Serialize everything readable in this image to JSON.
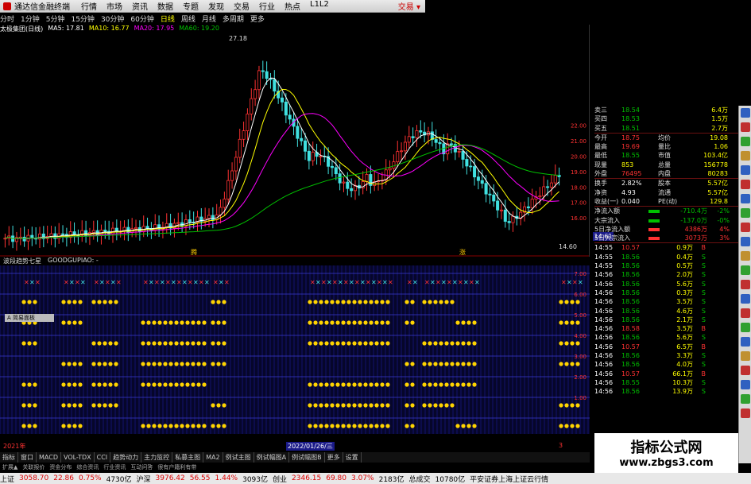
{
  "app": {
    "title": "通达信金融终端",
    "trade": "交易 ▾",
    "menus": [
      "行情",
      "市场",
      "资讯",
      "数据",
      "专题",
      "发现",
      "交易",
      "行业",
      "热点",
      "L1L2"
    ]
  },
  "periods": [
    "分时",
    "1分钟",
    "5分钟",
    "15分钟",
    "30分钟",
    "60分钟",
    "日线",
    "周线",
    "月线",
    "多周期",
    "更多"
  ],
  "stock": {
    "name": "太极集团(日线)",
    "ma": [
      {
        "label": "MA5: 17.81",
        "color": "#ffffff"
      },
      {
        "label": "MA10: 16.77",
        "color": "#ffff00"
      },
      {
        "label": "MA20: 17.95",
        "color": "#ff00ff"
      },
      {
        "label": "MA60: 19.20",
        "color": "#00c000"
      }
    ]
  },
  "chart_data": {
    "type": "candlestick",
    "high_label": "27.18",
    "low_label": "14.60",
    "price_tag": "14.61",
    "right_axis": [
      "22.00",
      "21.00",
      "20.00",
      "19.00",
      "18.00",
      "17.00",
      "16.00"
    ],
    "indicator_axis": [
      "7.00",
      "6.00",
      "5.00",
      "4.00",
      "3.00",
      "2.00",
      "1.00"
    ],
    "markers": [
      "腾",
      "涨"
    ],
    "dot_rows": 7,
    "segments": [
      [
        80,
        3
      ],
      [
        30,
        3
      ],
      [
        80,
        3
      ],
      [
        30,
        3
      ],
      [
        80,
        3
      ],
      [
        30,
        3
      ]
    ]
  },
  "indicator": {
    "title": "波段趋势七星",
    "code": "GOODGUPIAO: -",
    "mini_button": "A 简易面板"
  },
  "dates": {
    "left": "2021年",
    "mid": "2022/01/26/三",
    "right": "3"
  },
  "tabs": [
    "指标",
    "窗口",
    "MACD",
    "VOL-TDX",
    "CCI",
    "趋势动力",
    "主力监控",
    "私募主图",
    "MA2",
    "例试主图",
    "例试幅图A",
    "例试幅图B",
    "更多",
    "设置"
  ],
  "tabs2": [
    "扩展▲",
    "关联报价",
    "资金分布",
    "综合资讯",
    "行业资讯",
    "互动问答",
    "很有户籍利有带"
  ],
  "quote": {
    "asks": [
      {
        "l": "卖三",
        "p": "18.54",
        "v": "6.4万"
      },
      {
        "l": "买四",
        "p": "18.53",
        "v": "1.5万"
      },
      {
        "l": "买五",
        "p": "18.51",
        "v": "2.7万"
      }
    ],
    "stats": [
      {
        "a": "今开",
        "b": "18.75",
        "c": "均价",
        "d": "19.08"
      },
      {
        "a": "最高",
        "b": "19.69",
        "c": "量比",
        "d": "1.06"
      },
      {
        "a": "最低",
        "b": "18.55",
        "c": "市值",
        "d": "103.4亿"
      },
      {
        "a": "现量",
        "b": "853",
        "c": "总量",
        "d": "156778"
      },
      {
        "a": "外盘",
        "b": "76495",
        "c": "内盘",
        "d": "80283"
      }
    ],
    "fin": [
      {
        "a": "换手",
        "b": "2.82%",
        "c": "股本",
        "d": "5.57亿"
      },
      {
        "a": "净资",
        "b": "4.93",
        "c": "流通",
        "d": "5.57亿"
      },
      {
        "a": "收益(一)",
        "b": "0.040",
        "c": "PE(动)",
        "d": "129.8"
      }
    ],
    "flows": [
      {
        "a": "净流入额",
        "b": "-710.4万",
        "c": "-2%"
      },
      {
        "a": "大宗流入",
        "b": "-137.0万",
        "c": "-0%"
      },
      {
        "a": "5日净流入额",
        "b": "4386万",
        "c": "4%"
      },
      {
        "a": "5日大宗流入",
        "b": "3073万",
        "c": "3%"
      }
    ],
    "ticks": [
      {
        "t": "14:55",
        "p": "10.57",
        "v": "0.9万",
        "s": "B"
      },
      {
        "t": "14:55",
        "p": "18.56",
        "v": "0.4万",
        "s": "S"
      },
      {
        "t": "14:55",
        "p": "18.56",
        "v": "0.5万",
        "s": "S"
      },
      {
        "t": "14:56",
        "p": "18.56",
        "v": "2.0万",
        "s": "S"
      },
      {
        "t": "14:56",
        "p": "18.56",
        "v": "5.6万",
        "s": "S"
      },
      {
        "t": "14:56",
        "p": "18.56",
        "v": "0.3万",
        "s": "S"
      },
      {
        "t": "14:56",
        "p": "18.56",
        "v": "3.5万",
        "s": "S"
      },
      {
        "t": "14:56",
        "p": "18.56",
        "v": "4.6万",
        "s": "S"
      },
      {
        "t": "14:56",
        "p": "18.56",
        "v": "2.1万",
        "s": "S"
      },
      {
        "t": "14:56",
        "p": "18.58",
        "v": "3.5万",
        "s": "B"
      },
      {
        "t": "14:56",
        "p": "18.56",
        "v": "5.6万",
        "s": "S"
      },
      {
        "t": "14:56",
        "p": "10.57",
        "v": "6.5万",
        "s": "B"
      },
      {
        "t": "14:56",
        "p": "18.56",
        "v": "3.3万",
        "s": "S"
      },
      {
        "t": "14:56",
        "p": "18.56",
        "v": "4.0万",
        "s": "S"
      },
      {
        "t": "14:56",
        "p": "10.57",
        "v": "66.1万",
        "s": "B"
      },
      {
        "t": "14:56",
        "p": "18.55",
        "v": "10.3万",
        "s": "S"
      },
      {
        "t": "14:56",
        "p": "18.56",
        "v": "13.9万",
        "s": "S"
      },
      {
        "t": "14:56",
        "p": "18.56",
        "v": "10.0万",
        "s": "S"
      },
      {
        "t": "14:56",
        "p": "18.56",
        "v": "10.7万",
        "s": "S"
      }
    ]
  },
  "watermark": {
    "cn": "指标公式网",
    "url": "www.zbgs3.com"
  },
  "status": {
    "items": [
      {
        "t": "上证",
        "c": "#000"
      },
      {
        "t": "3058.70",
        "c": "#d00"
      },
      {
        "t": "22.86",
        "c": "#d00"
      },
      {
        "t": "0.75%",
        "c": "#d00"
      },
      {
        "t": "4730亿",
        "c": "#000"
      },
      {
        "t": "沪深",
        "c": "#000"
      },
      {
        "t": "3976.42",
        "c": "#d00"
      },
      {
        "t": "56.55",
        "c": "#d00"
      },
      {
        "t": "1.44%",
        "c": "#d00"
      },
      {
        "t": "3093亿",
        "c": "#000"
      },
      {
        "t": "创业",
        "c": "#000"
      },
      {
        "t": "2346.15",
        "c": "#d00"
      },
      {
        "t": "69.80",
        "c": "#d00"
      },
      {
        "t": "3.07%",
        "c": "#d00"
      },
      {
        "t": "2183亿",
        "c": "#000"
      },
      {
        "t": "总成交",
        "c": "#000"
      },
      {
        "t": "10780亿",
        "c": "#000"
      },
      {
        "t": "平安证券上海上证云行情",
        "c": "#000"
      }
    ]
  }
}
